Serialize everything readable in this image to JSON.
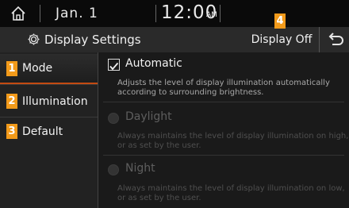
{
  "status_bar": {
    "date": "Jan.  1",
    "time": "12:00",
    "ampm": "AM"
  },
  "header": {
    "title": "Display Settings",
    "display_off_label": "Display Off"
  },
  "sidebar": {
    "items": [
      {
        "label": "Mode",
        "selected": true
      },
      {
        "label": "Illumination"
      },
      {
        "label": "Default"
      }
    ]
  },
  "content": {
    "options": [
      {
        "title": "Automatic",
        "checked": true,
        "description": "Adjusts the level of display illumination automatically according to surrounding brightness."
      },
      {
        "title": "Daylight",
        "description": "Always maintains the level of display illumination on high, or as set by the user."
      },
      {
        "title": "Night",
        "description": "Always maintains the level of display illumination on low, or as set by the user."
      }
    ]
  },
  "callouts": [
    "1",
    "2",
    "3",
    "4"
  ],
  "colors": {
    "accent": "#c44b12",
    "badge": "#f29a1a",
    "disabled_text": "#5e5e5e"
  }
}
